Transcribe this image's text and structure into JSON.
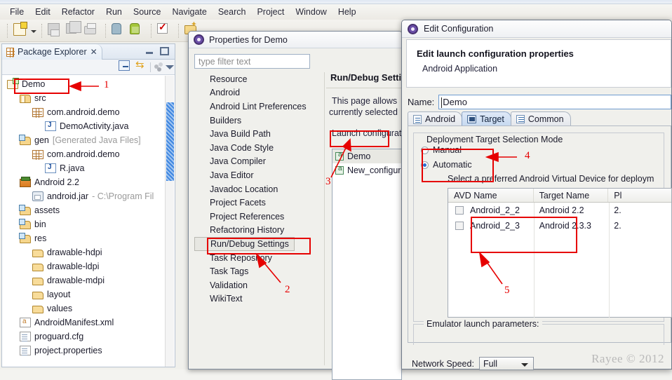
{
  "app": {
    "menu": [
      "File",
      "Edit",
      "Refactor",
      "Run",
      "Source",
      "Navigate",
      "Search",
      "Project",
      "Window",
      "Help"
    ],
    "toolbar_icons": [
      "new-document-icon",
      "dropdown-caret-icon",
      "save-icon",
      "save-all-icon",
      "print-icon",
      "android-sdk-manager-icon",
      "android-avd-manager-icon",
      "check-icon",
      "open-type-icon"
    ]
  },
  "package_explorer": {
    "tab_label": "Package Explorer",
    "close_glyph": "✕",
    "toolbar_icons": [
      "collapse-all-icon",
      "link-with-editor-icon",
      "view-menu-dots-icon",
      "view-menu-icon"
    ],
    "tree": [
      {
        "label": "Demo",
        "indent": 0,
        "icon": "project-icon",
        "selected": true
      },
      {
        "label": "src",
        "indent": 1,
        "icon": "source-folder-icon"
      },
      {
        "label": "com.android.demo",
        "indent": 2,
        "icon": "package-icon"
      },
      {
        "label": "DemoActivity.java",
        "indent": 3,
        "icon": "java-file-icon"
      },
      {
        "label": "gen",
        "suffix": " [Generated Java Files]",
        "indent": 1,
        "icon": "generated-folder-icon"
      },
      {
        "label": "com.android.demo",
        "indent": 2,
        "icon": "package-icon"
      },
      {
        "label": "R.java",
        "indent": 3,
        "icon": "java-file-icon"
      },
      {
        "label": "Android 2.2",
        "indent": 1,
        "icon": "library-icon"
      },
      {
        "label": "android.jar",
        "suffix": " - C:\\Program Fil",
        "indent": 2,
        "icon": "jar-icon"
      },
      {
        "label": "assets",
        "indent": 1,
        "icon": "generated-folder-icon"
      },
      {
        "label": "bin",
        "indent": 1,
        "icon": "generated-folder-icon"
      },
      {
        "label": "res",
        "indent": 1,
        "icon": "generated-folder-icon"
      },
      {
        "label": "drawable-hdpi",
        "indent": 2,
        "icon": "folder-icon"
      },
      {
        "label": "drawable-ldpi",
        "indent": 2,
        "icon": "folder-icon"
      },
      {
        "label": "drawable-mdpi",
        "indent": 2,
        "icon": "folder-icon"
      },
      {
        "label": "layout",
        "indent": 2,
        "icon": "folder-icon"
      },
      {
        "label": "values",
        "indent": 2,
        "icon": "folder-icon"
      },
      {
        "label": "AndroidManifest.xml",
        "indent": 1,
        "icon": "xml-file-icon"
      },
      {
        "label": "proguard.cfg",
        "indent": 1,
        "icon": "file-icon"
      },
      {
        "label": "project.properties",
        "indent": 1,
        "icon": "file-icon"
      }
    ]
  },
  "properties_dialog": {
    "title": "Properties for Demo",
    "title_icon": "gear-icon",
    "filter_placeholder": "type filter text",
    "filter_value": "",
    "items": [
      "Resource",
      "Android",
      "Android Lint Preferences",
      "Builders",
      "Java Build Path",
      "Java Code Style",
      "Java Compiler",
      "Java Editor",
      "Javadoc Location",
      "Project Facets",
      "Project References",
      "Refactoring History",
      "Run/Debug Settings",
      "Task Repository",
      "Task Tags",
      "Validation",
      "WikiText"
    ],
    "selected_item": "Run/Debug Settings",
    "page_title": "Run/Debug Settin",
    "desc_line1": "This page allows",
    "desc_line2": "currently selected",
    "launch_label": "Launch configurat",
    "launch_items": [
      {
        "label": "Demo",
        "icon": "launch-config-icon",
        "selected": true
      },
      {
        "label": "New_configur",
        "icon": "launch-config-icon",
        "selected": false
      }
    ]
  },
  "edit_configuration": {
    "title": "Edit Configuration",
    "title_icon": "gear-icon",
    "header_title": "Edit launch configuration properties",
    "header_subtitle": "Android Application",
    "name_label": "Name:",
    "name_value": "Demo",
    "tabs": [
      {
        "label": "Android",
        "icon": "android-tab-icon",
        "active": false
      },
      {
        "label": "Target",
        "icon": "target-tab-icon",
        "active": true
      },
      {
        "label": "Common",
        "icon": "common-tab-icon",
        "active": false
      }
    ],
    "group_label": "Deployment Target Selection Mode",
    "radios": [
      {
        "label": "Manual",
        "selected": false
      },
      {
        "label": "Automatic",
        "selected": true
      }
    ],
    "avd_hint": "Select a preferred Android Virtual Device for deploym",
    "avd_columns": [
      "AVD Name",
      "Target Name",
      "Pl"
    ],
    "avd_rows": [
      {
        "checked": false,
        "avd_name": "Android_2_2",
        "target_name": "Android 2.2",
        "platform": "2."
      },
      {
        "checked": false,
        "avd_name": "Android_2_3",
        "target_name": "Android 2.3.3",
        "platform": "2."
      }
    ],
    "emulator_group_label": "Emulator launch parameters:",
    "network_speed_label": "Network Speed:",
    "network_speed_value": "Full"
  },
  "annotations": {
    "markers": [
      "1",
      "2",
      "3",
      "4",
      "5"
    ],
    "color": "#e60000"
  },
  "watermark": "Rayee © 2012"
}
